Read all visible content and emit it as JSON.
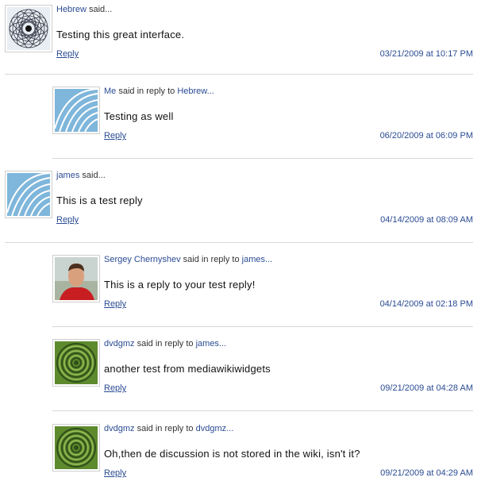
{
  "comments": [
    {
      "author": "Hebrew",
      "said": "said...",
      "reply_to": "",
      "text": "Testing this great interface.",
      "reply": "Reply",
      "date": "03/21/2009 at 10:17 PM",
      "avatar": "spiral-avatar"
    },
    {
      "author": "Me",
      "said": "said in reply to",
      "reply_to": "Hebrew...",
      "text": "Testing as well",
      "reply": "Reply",
      "date": "06/20/2009 at 06:09 PM",
      "avatar": "blue-curves-avatar"
    },
    {
      "author": "james",
      "said": "said...",
      "reply_to": "",
      "text": "This is a test reply",
      "reply": "Reply",
      "date": "04/14/2009 at 08:09 AM",
      "avatar": "blue-curves-avatar"
    },
    {
      "author": "Sergey Chernyshev",
      "said": "said in reply to",
      "reply_to": "james...",
      "text": "This is a reply to your test reply!",
      "reply": "Reply",
      "date": "04/14/2009 at 02:18 PM",
      "avatar": "photo-avatar"
    },
    {
      "author": "dvdgmz",
      "said": "said in reply to",
      "reply_to": "james...",
      "text": "another test from mediawikiwidgets",
      "reply": "Reply",
      "date": "09/21/2009 at 04:28 AM",
      "avatar": "green-pattern-avatar"
    },
    {
      "author": "dvdgmz",
      "said": "said in reply to",
      "reply_to": "dvdgmz...",
      "text": "Oh,then de discussion is not stored in the wiki, isn't it?",
      "reply": "Reply",
      "date": "09/21/2009 at 04:29 AM",
      "avatar": "green-pattern-avatar"
    }
  ]
}
